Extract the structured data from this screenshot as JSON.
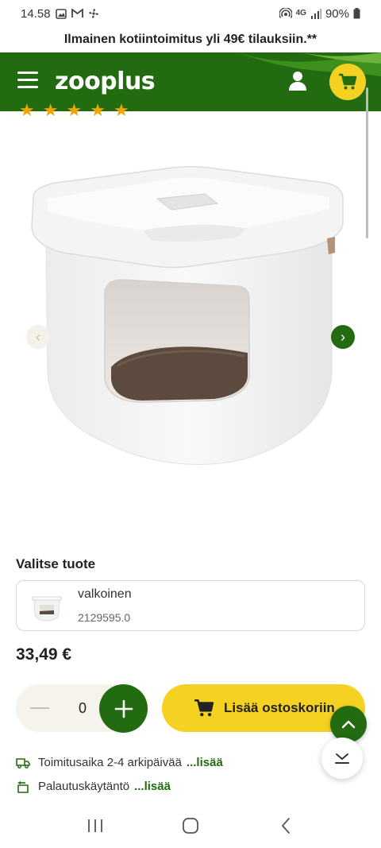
{
  "status_bar": {
    "time": "14.58",
    "network": "4G",
    "battery": "90%"
  },
  "promo": {
    "text": "Ilmainen kotiintoimitus yli 49€ tilauksiin.**"
  },
  "header": {
    "logo": "zooplus",
    "icons": [
      "menu-icon",
      "user-icon",
      "cart-icon"
    ],
    "brand_color": "#236b10",
    "accent_color": "#f5d221"
  },
  "product": {
    "rating_stars": 5
  },
  "variant": {
    "section_title": "Valitse tuote",
    "name": "valkoinen",
    "code": "2129595.0"
  },
  "price": "33,49 €",
  "quantity": {
    "value": "0"
  },
  "add_to_cart": {
    "label": "Lisää ostoskoriin"
  },
  "info": {
    "delivery_text": "Toimitusaika 2-4 arkipäivää",
    "delivery_more": "...lisää",
    "returns_text": "Palautuskäytäntö",
    "returns_more": "...lisää"
  }
}
